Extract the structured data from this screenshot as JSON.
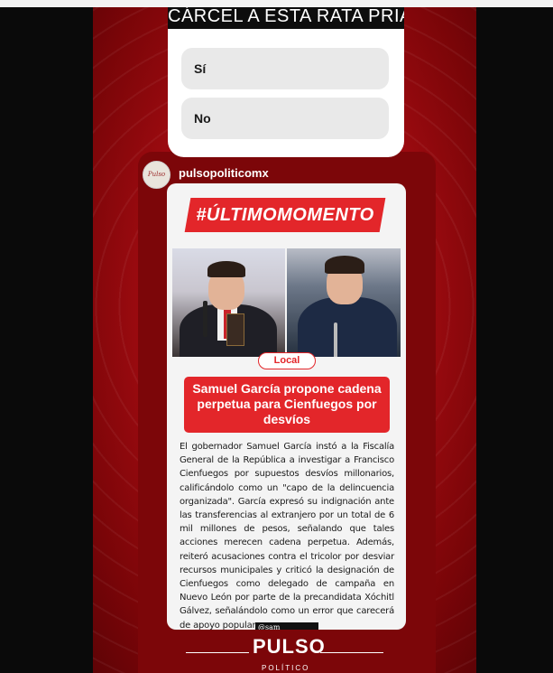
{
  "poll": {
    "question": "CÁRCEL A ESTA RATA PRIAN",
    "options": [
      "Sí",
      "No"
    ]
  },
  "post": {
    "username": "pulsopoliticomx",
    "avatar_label": "Pulso",
    "banner": "#ÚLTIMOMOMENTO",
    "tag": "Local",
    "headline": "Samuel García propone cadena perpetua para Cienfuegos por desvíos",
    "body": "El gobernador Samuel García instó a la Fiscalía General de la República a investigar a Francisco Cienfuegos por supuestos desvíos millonarios, calificándolo como un \"capo de la delincuencia organizada\". García expresó su indignación ante las transferencias al extranjero por un total de 6 mil millones de pesos, señalando que tales acciones merecen cadena perpetua. Además, reiteró acusaciones contra el tricolor por desviar recursos municipales y criticó la designación de Cienfuegos como delegado de campaña en Nuevo León por parte de la precandidata Xóchitl Gálvez, señalándolo como un error que carecerá de apoyo popular.",
    "photo_credit": "@sam"
  },
  "footer": {
    "logo": "PULSO",
    "logo_sub": "POLÍTICO"
  },
  "colors": {
    "accent_red": "#e3262a",
    "background_red": "#a50c12"
  }
}
